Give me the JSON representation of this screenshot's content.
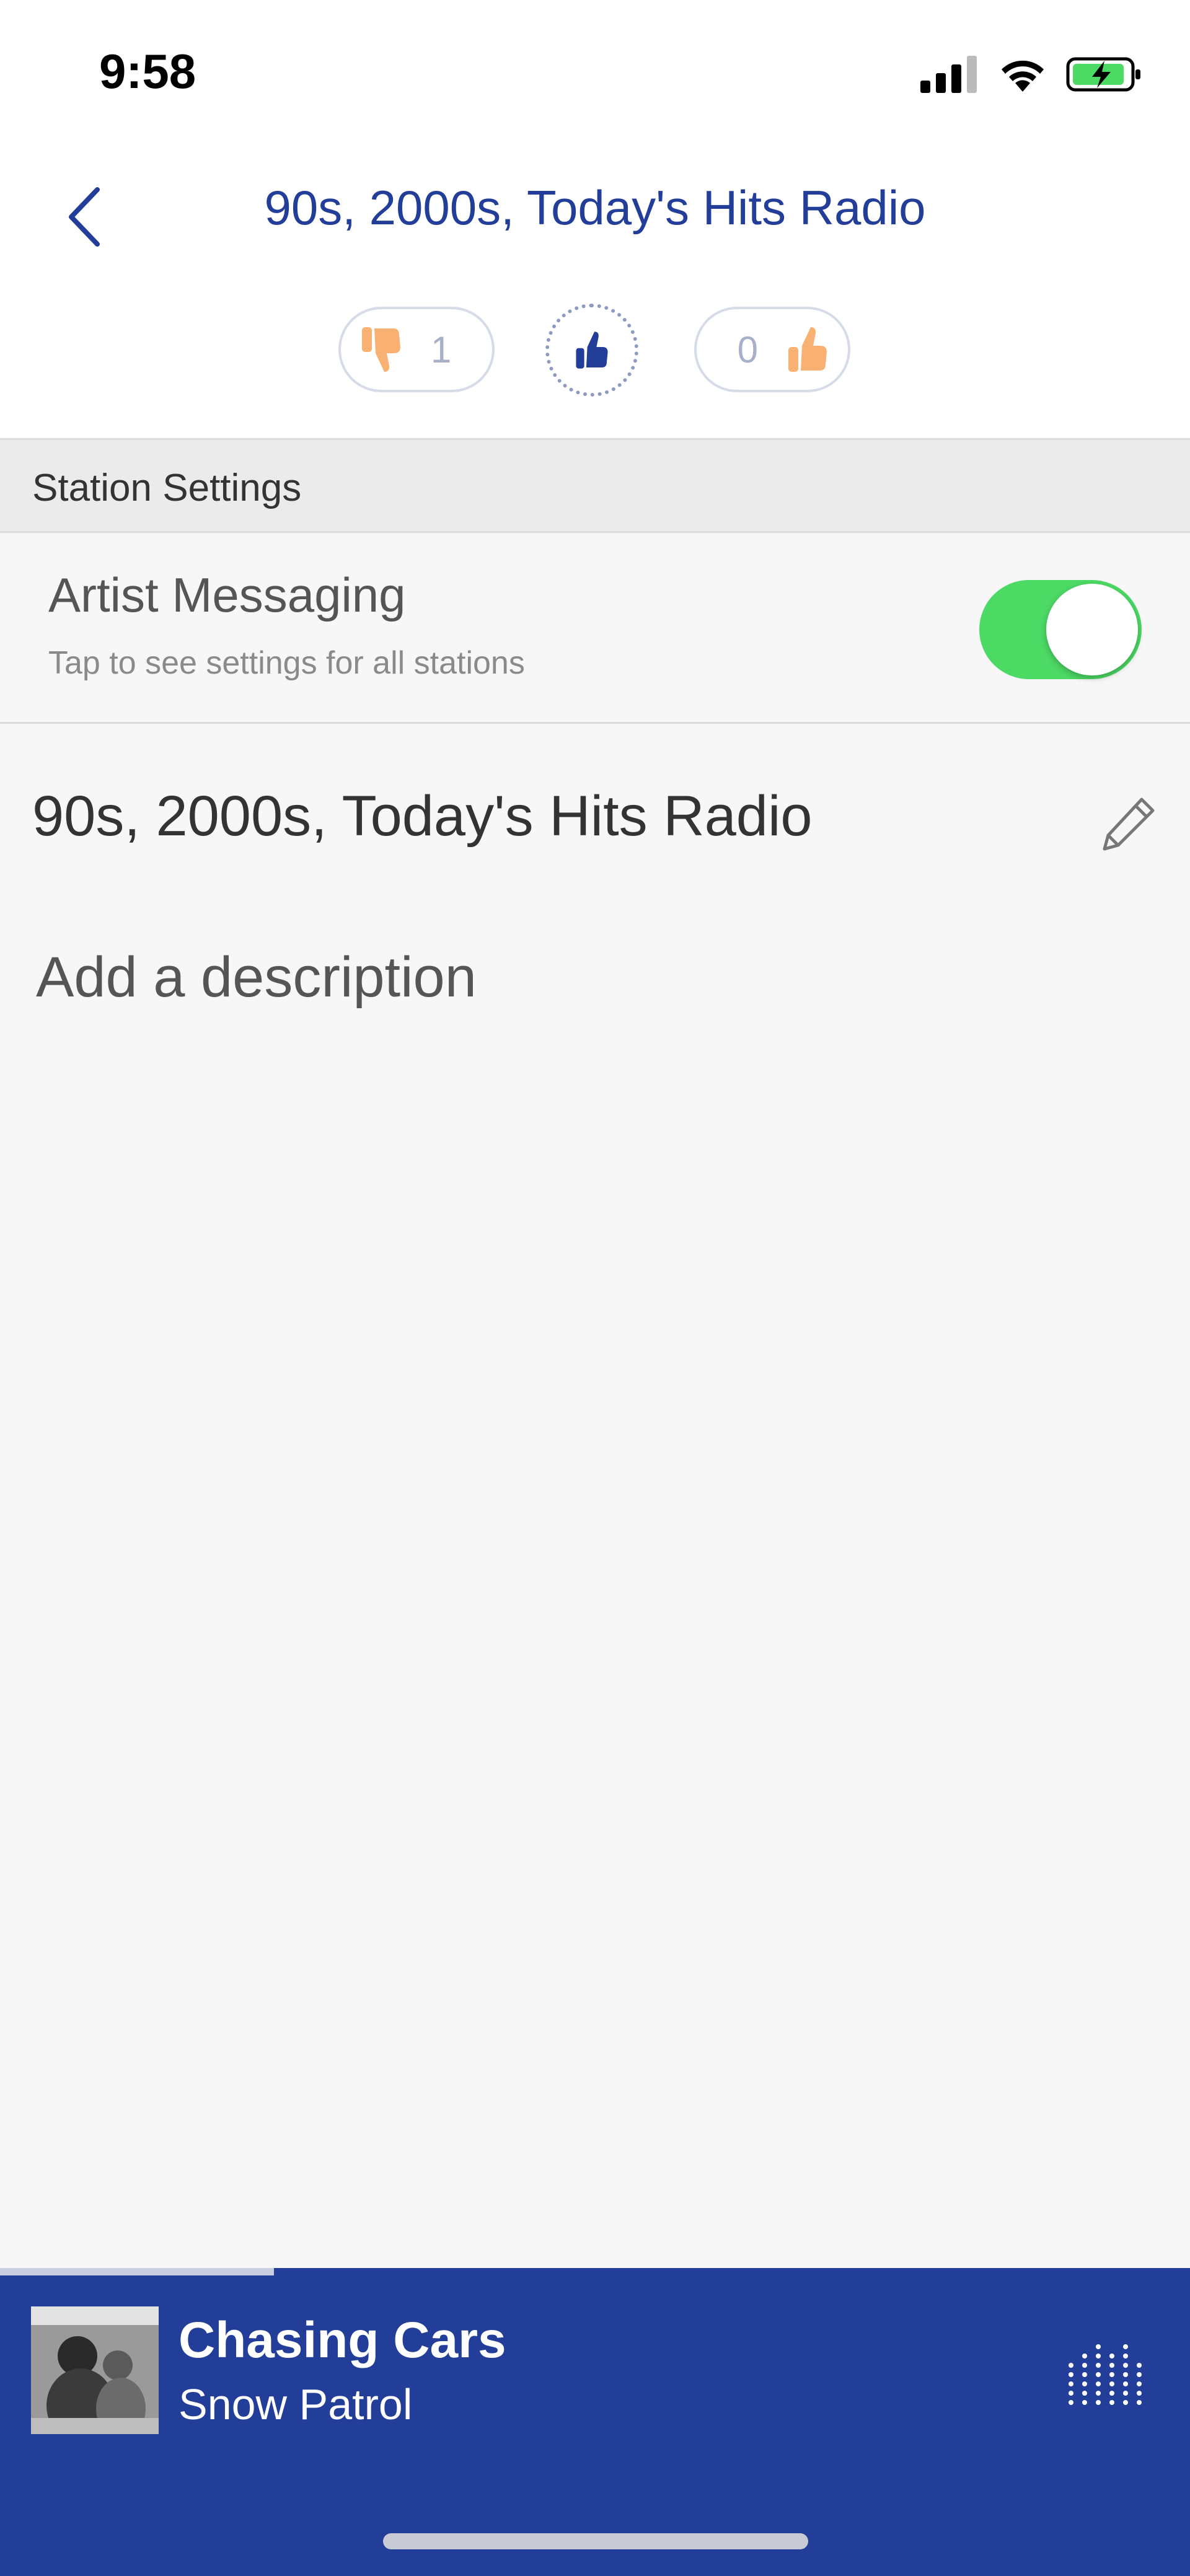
{
  "status_bar": {
    "time": "9:58"
  },
  "header": {
    "title": "90s, 2000s, Today's Hits Radio"
  },
  "ratings": {
    "thumbs_down_count": "1",
    "thumbs_up_count": "0"
  },
  "station_settings": {
    "section_title": "Station Settings",
    "artist_messaging": {
      "label": "Artist Messaging",
      "subtitle": "Tap to see settings for all stations",
      "enabled": true
    },
    "station_name": "90s, 2000s, Today's Hits Radio",
    "description_placeholder": "Add a description"
  },
  "now_playing": {
    "track": "Chasing Cars",
    "artist": "Snow Patrol",
    "progress": 0.23
  },
  "colors": {
    "accent_blue": "#223e98",
    "toggle_green": "#4cd964",
    "thumb_orange": "#f9b073"
  }
}
